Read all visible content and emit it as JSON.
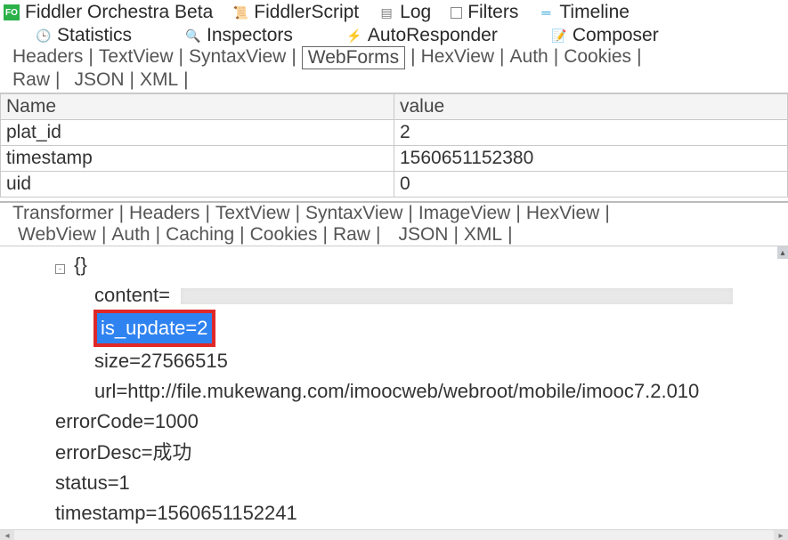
{
  "top_tabs": {
    "orchestra": "Fiddler Orchestra Beta",
    "fscript": "FiddlerScript",
    "log": "Log",
    "filters": "Filters",
    "timeline": "Timeline",
    "stats": "Statistics",
    "inspectors": "Inspectors",
    "autoresponder": "AutoResponder",
    "composer": "Composer"
  },
  "req_subtabs": {
    "headers": "Headers",
    "textview": "TextView",
    "syntax": "SyntaxView",
    "webforms": "WebForms",
    "hex": "HexView",
    "auth": "Auth",
    "cookies": "Cookies",
    "raw": "Raw",
    "json": "JSON",
    "xml": "XML"
  },
  "table": {
    "col_name": "Name",
    "col_value": "value",
    "rows": [
      {
        "name": "plat_id",
        "value": "2"
      },
      {
        "name": "timestamp",
        "value": "1560651152380"
      },
      {
        "name": "uid",
        "value": "0"
      }
    ]
  },
  "resp_subtabs": {
    "transformer": "Transformer",
    "headers": "Headers",
    "textview": "TextView",
    "syntax": "SyntaxView",
    "imageview": "ImageView",
    "hex": "HexView",
    "webview": "WebView",
    "auth": "Auth",
    "caching": "Caching",
    "cookies": "Cookies",
    "raw": "Raw",
    "json": "JSON",
    "xml": "XML"
  },
  "json_tree": {
    "root": "{}",
    "content_key": "content=",
    "is_update": "is_update=2",
    "size": "size=27566515",
    "url": "url=http://file.mukewang.com/imoocweb/webroot/mobile/imooc7.2.010",
    "errorCode": "errorCode=1000",
    "errorDesc": "errorDesc=成功",
    "status": "status=1",
    "timestamp": "timestamp=1560651152241"
  }
}
